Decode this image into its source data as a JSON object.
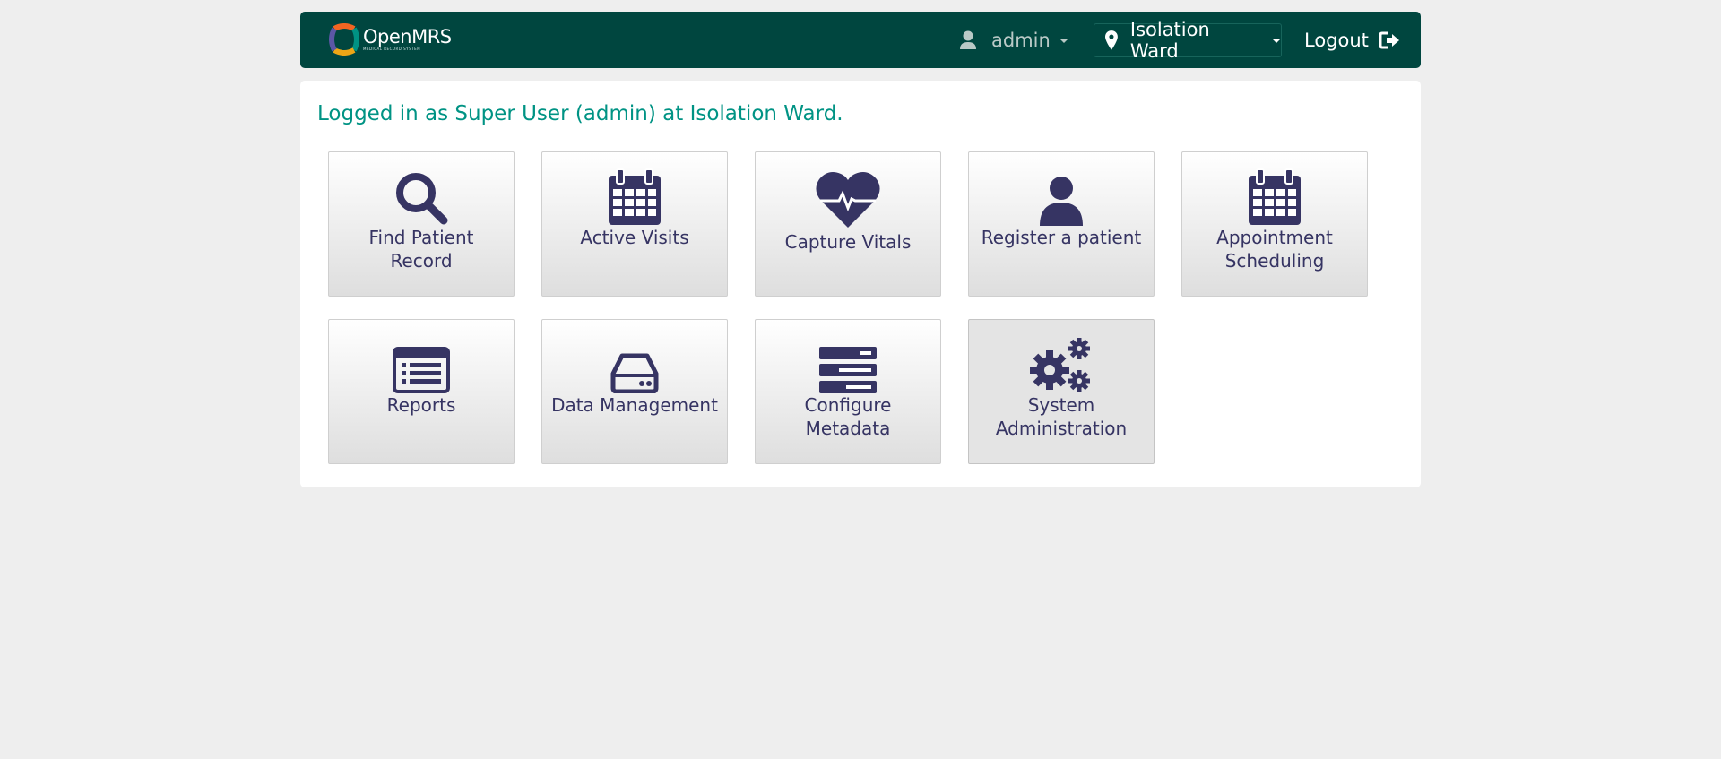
{
  "header": {
    "logo_text": "OpenMRS",
    "logo_subtext": "MEDICAL RECORD SYSTEM",
    "user": "admin",
    "location": "Isolation Ward",
    "logout_label": "Logout"
  },
  "welcome_message": "Logged in as Super User (admin) at Isolation Ward.",
  "apps": [
    {
      "label": "Find Patient Record",
      "icon": "search-icon"
    },
    {
      "label": "Active Visits",
      "icon": "calendar-icon"
    },
    {
      "label": "Capture Vitals",
      "icon": "heartbeat-icon"
    },
    {
      "label": "Register a patient",
      "icon": "user-icon"
    },
    {
      "label": "Appointment Scheduling",
      "icon": "calendar-icon"
    },
    {
      "label": "Reports",
      "icon": "list-icon"
    },
    {
      "label": "Data Management",
      "icon": "hdd-icon"
    },
    {
      "label": "Configure Metadata",
      "icon": "server-icon"
    },
    {
      "label": "System Administration",
      "icon": "cogs-icon"
    }
  ],
  "colors": {
    "header_bg": "#00463f",
    "welcome_text": "#009384",
    "icon_color": "#363463",
    "page_bg": "#eeeeee"
  }
}
